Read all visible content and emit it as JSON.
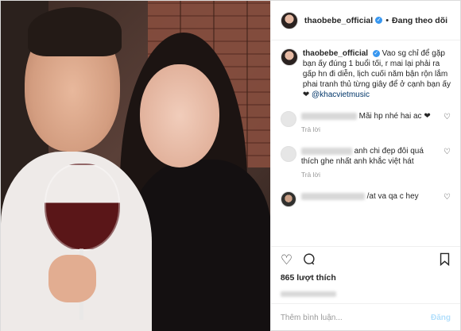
{
  "header": {
    "username": "thaobebe_official",
    "separator": "•",
    "follow_status": "Đang theo dõi"
  },
  "caption": {
    "username": "thaobebe_official",
    "text": "Vao sg chỉ để gặp bạn ấy đúng 1 buổi tối, r mai lại phải ra gấp hn đi diễn, lịch cuối năm bận rộn lắm phai tranh thủ từng giây để ở cạnh bạn ấy ❤",
    "mention": "@khacvietmusic"
  },
  "comments": [
    {
      "text": "Mãi hp nhé hai ac ❤",
      "reply": "Trả lời"
    },
    {
      "text": "anh chi đẹp đôi quá thích ghe nhất anh khắc việt hát",
      "reply": "Trả lời"
    },
    {
      "text": "/at va qa c hey",
      "reply": ""
    }
  ],
  "actions": {
    "like_icon": "heart-icon",
    "comment_icon": "comment-icon",
    "share_icon": "share-icon",
    "save_icon": "bookmark-icon"
  },
  "likes": "865 lượt thích",
  "add_comment": {
    "placeholder": "Thêm bình luận...",
    "post_label": "Đăng"
  },
  "colors": {
    "verified": "#3897f0",
    "mention": "#003569",
    "post_disabled": "#b2dffc"
  }
}
